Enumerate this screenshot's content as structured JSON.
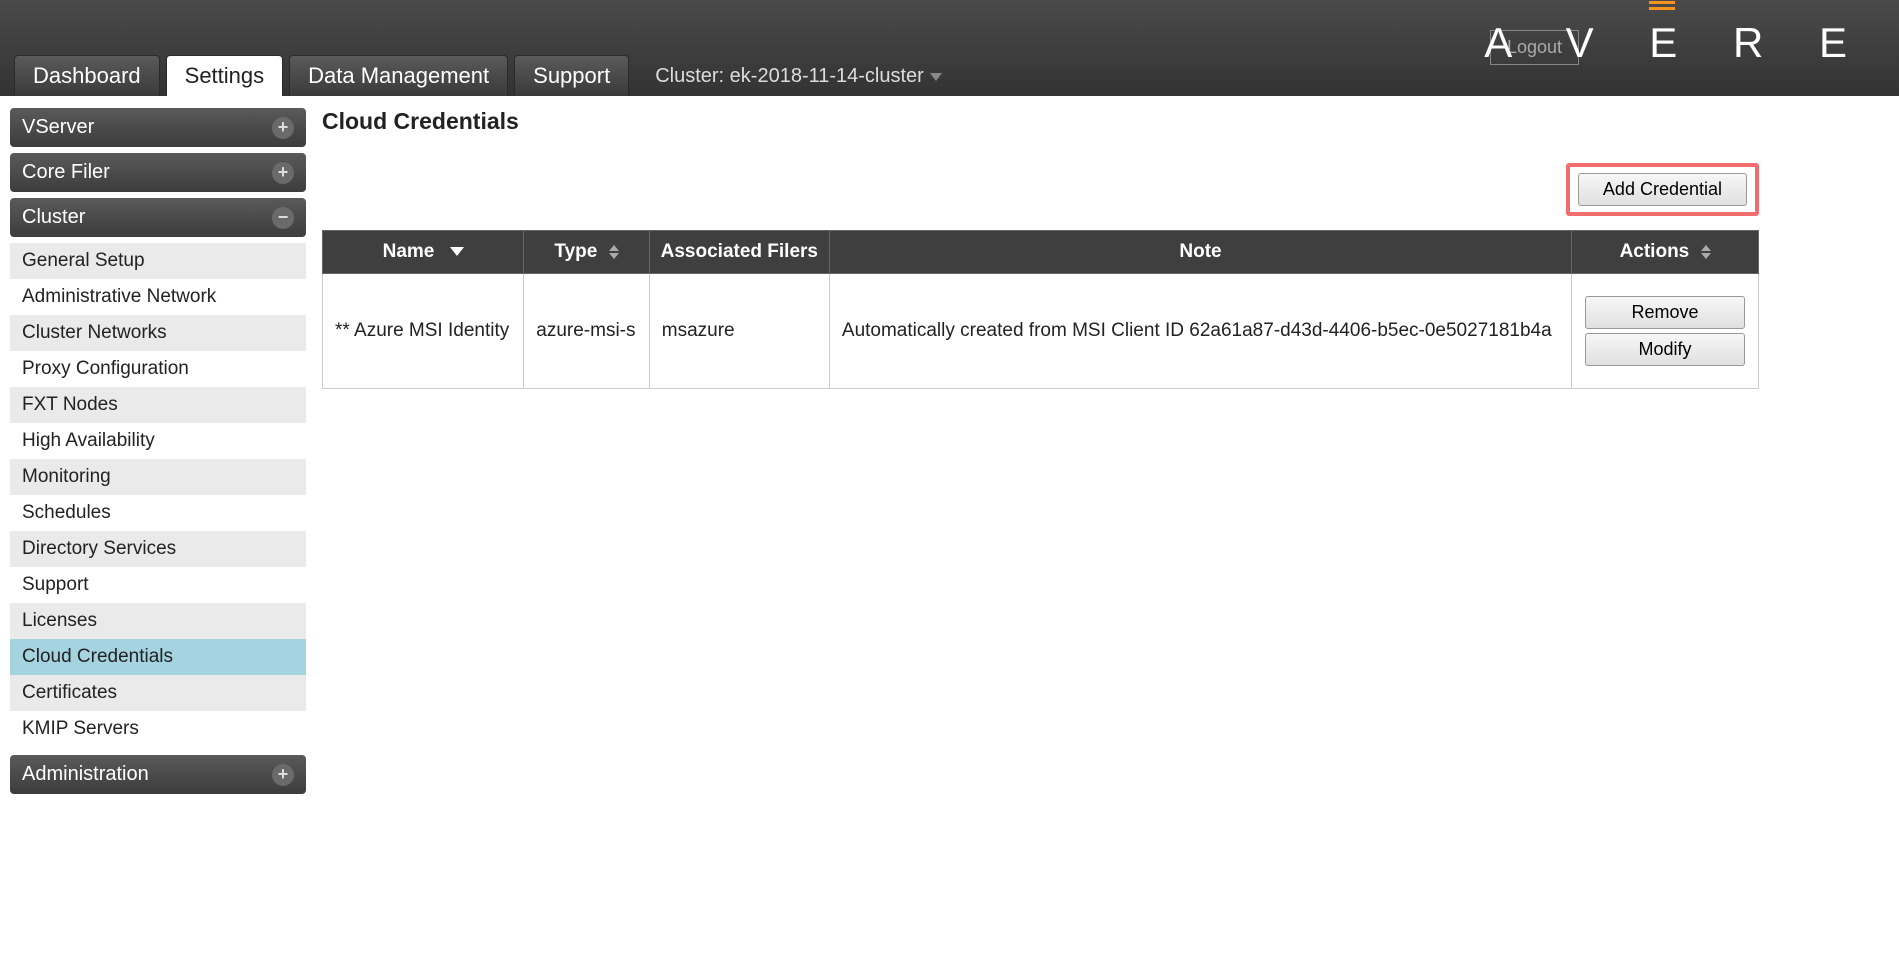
{
  "header": {
    "tabs": [
      {
        "label": "Dashboard",
        "active": false
      },
      {
        "label": "Settings",
        "active": true
      },
      {
        "label": "Data Management",
        "active": false
      },
      {
        "label": "Support",
        "active": false
      }
    ],
    "cluster_label": "Cluster: ek-2018-11-14-cluster",
    "logout": "Logout",
    "brand": "AVERE"
  },
  "sidebar": {
    "sections": [
      {
        "title": "VServer",
        "expanded": false,
        "items": []
      },
      {
        "title": "Core Filer",
        "expanded": false,
        "items": []
      },
      {
        "title": "Cluster",
        "expanded": true,
        "items": [
          {
            "label": "General Setup",
            "active": false
          },
          {
            "label": "Administrative Network",
            "active": false
          },
          {
            "label": "Cluster Networks",
            "active": false
          },
          {
            "label": "Proxy Configuration",
            "active": false
          },
          {
            "label": "FXT Nodes",
            "active": false
          },
          {
            "label": "High Availability",
            "active": false
          },
          {
            "label": "Monitoring",
            "active": false
          },
          {
            "label": "Schedules",
            "active": false
          },
          {
            "label": "Directory Services",
            "active": false
          },
          {
            "label": "Support",
            "active": false
          },
          {
            "label": "Licenses",
            "active": false
          },
          {
            "label": "Cloud Credentials",
            "active": true
          },
          {
            "label": "Certificates",
            "active": false
          },
          {
            "label": "KMIP Servers",
            "active": false
          }
        ]
      },
      {
        "title": "Administration",
        "expanded": false,
        "items": []
      }
    ]
  },
  "main": {
    "title": "Cloud Credentials",
    "add_button": "Add Credential",
    "columns": {
      "name": "Name",
      "type": "Type",
      "filers": "Associated Filers",
      "note": "Note",
      "actions": "Actions"
    },
    "rows": [
      {
        "name": "** Azure MSI Identity",
        "type": "azure-msi-s",
        "filers": "msazure",
        "note": "Automatically created from MSI Client ID 62a61a87-d43d-4406-b5ec-0e5027181b4a",
        "remove": "Remove",
        "modify": "Modify"
      }
    ]
  }
}
